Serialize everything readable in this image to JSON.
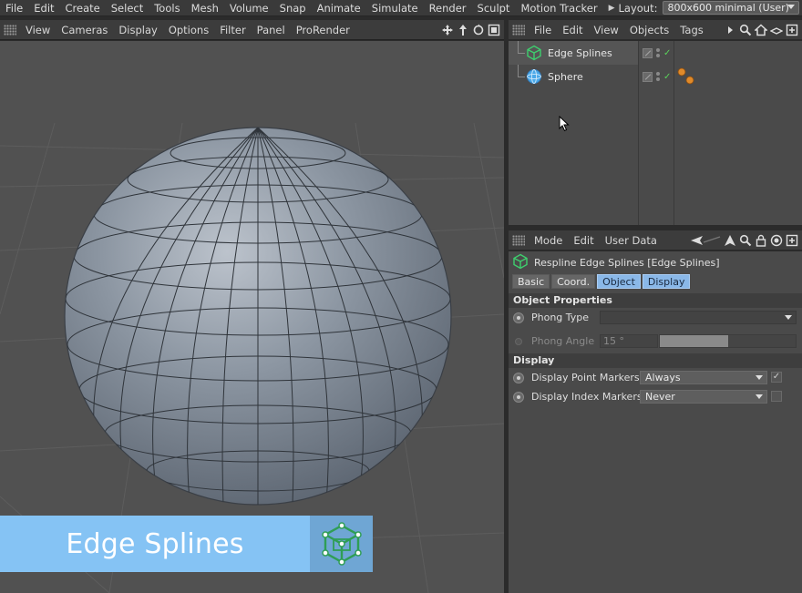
{
  "menubar": {
    "items": [
      "File",
      "Edit",
      "Create",
      "Select",
      "Tools",
      "Mesh",
      "Volume",
      "Snap",
      "Animate",
      "Simulate",
      "Render",
      "Sculpt",
      "Motion Tracker"
    ],
    "layout_label": "Layout:",
    "layout_value": "800x600 minimal (User)"
  },
  "viewport": {
    "menu": [
      "View",
      "Cameras",
      "Display",
      "Options",
      "Filter",
      "Panel",
      "ProRender"
    ]
  },
  "banner": {
    "text": "Edge Splines"
  },
  "object_manager": {
    "menu": [
      "File",
      "Edit",
      "View",
      "Objects",
      "Tags"
    ],
    "objects": [
      {
        "name": "Edge Splines",
        "icon": "edge-splines-icon"
      },
      {
        "name": "Sphere",
        "icon": "sphere-icon"
      }
    ]
  },
  "attribute_manager": {
    "menu": [
      "Mode",
      "Edit",
      "User Data"
    ],
    "title": "Respline Edge Splines [Edge Splines]",
    "tabs": [
      "Basic",
      "Coord.",
      "Object",
      "Display"
    ],
    "active_tabs": [
      "Object",
      "Display"
    ],
    "sections": {
      "object_properties": "Object Properties",
      "display": "Display"
    },
    "props": {
      "phong_type": {
        "label": "Phong Type",
        "value": ""
      },
      "phong_angle": {
        "label": "Phong Angle",
        "value": "15 °"
      },
      "display_point_markers": {
        "label": "Display Point Markers",
        "value": "Always",
        "checked": true
      },
      "display_index_markers": {
        "label": "Display Index Markers",
        "value": "Never",
        "checked": false
      }
    }
  },
  "colors": {
    "banner_bg": "#85c3f4",
    "tab_active": "#8ab8e8",
    "edge_splines_icon": "#3ecf6e",
    "sphere_icon": "#4aa8e8"
  }
}
